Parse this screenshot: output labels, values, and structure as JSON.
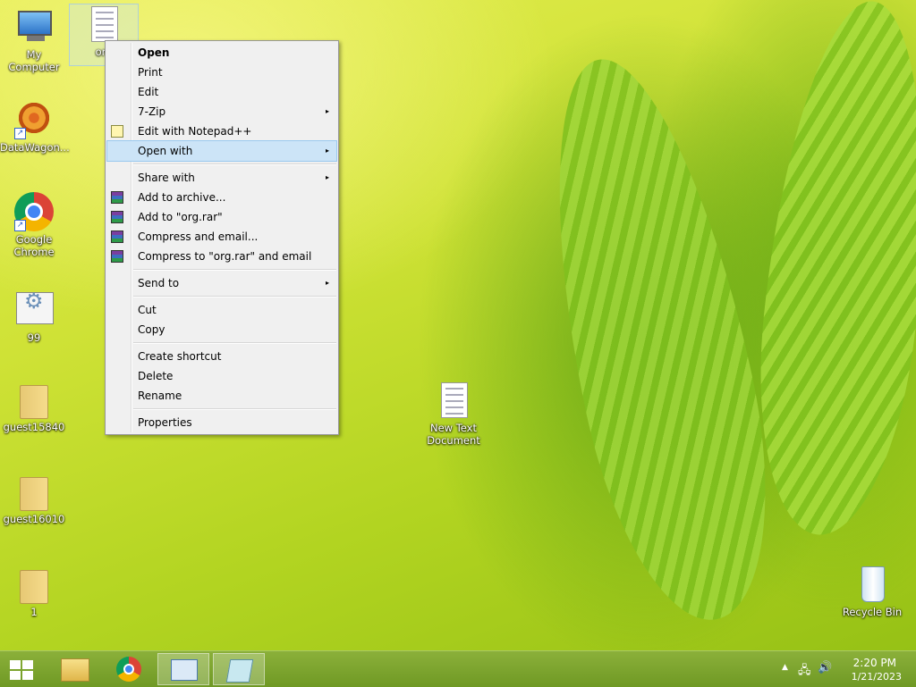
{
  "desktop": {
    "icons": [
      {
        "label": "My Computer"
      },
      {
        "label": "org"
      },
      {
        "label": "DataWagon..."
      },
      {
        "label": "Google Chrome"
      },
      {
        "label": "99"
      },
      {
        "label": "guest15840"
      },
      {
        "label": "guest16010"
      },
      {
        "label": "1"
      },
      {
        "label": "New Text Document"
      },
      {
        "label": "Recycle Bin"
      }
    ]
  },
  "context_menu": {
    "items": [
      {
        "label": "Open"
      },
      {
        "label": "Print"
      },
      {
        "label": "Edit"
      },
      {
        "label": "7-Zip"
      },
      {
        "label": "Edit with Notepad++"
      },
      {
        "label": "Open with"
      },
      {
        "label": "Share with"
      },
      {
        "label": "Add to archive..."
      },
      {
        "label": "Add to \"org.rar\""
      },
      {
        "label": "Compress and email..."
      },
      {
        "label": "Compress to \"org.rar\" and email"
      },
      {
        "label": "Send to"
      },
      {
        "label": "Cut"
      },
      {
        "label": "Copy"
      },
      {
        "label": "Create shortcut"
      },
      {
        "label": "Delete"
      },
      {
        "label": "Rename"
      },
      {
        "label": "Properties"
      }
    ],
    "submenu_arrow": "▸"
  },
  "taskbar": {
    "tray": {
      "arrow": "▲",
      "network": "🖧",
      "volume": "🔊",
      "time": "2:20 PM",
      "date": "1/21/2023"
    }
  },
  "colors": {
    "menu_highlight": "#cce4f7",
    "taskbar": "#7aa32c"
  }
}
